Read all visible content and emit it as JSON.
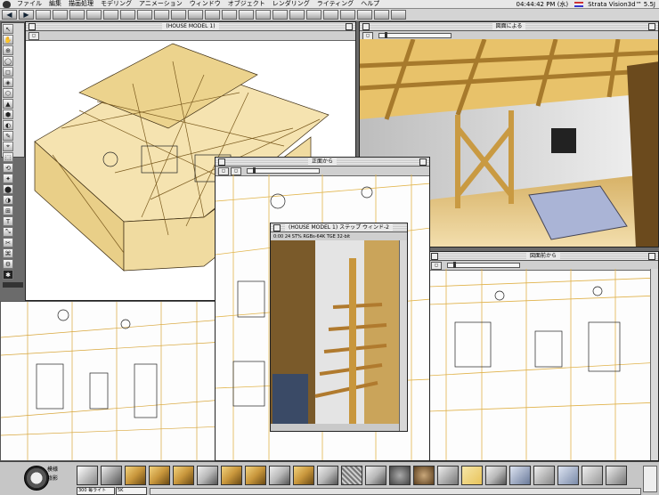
{
  "menubar": {
    "items": [
      "ファイル",
      "編集",
      "描画処理",
      "モデリング",
      "アニメーション",
      "ウィンドウ",
      "オブジェクト",
      "レンダリング",
      "ライティング",
      "ヘルプ"
    ],
    "clock": "04:44:42 PM (水)",
    "app_name": "Strata Vision3d™ 5.5J"
  },
  "toolbar": {
    "buttons": [
      "◀",
      "▶",
      "",
      "",
      "",
      "",
      "",
      "",
      "",
      "",
      "",
      "",
      "",
      "",
      "",
      "",
      "",
      "",
      "",
      "",
      "",
      "",
      "",
      ""
    ]
  },
  "palette": {
    "tools": [
      "↖",
      "✋",
      "⊕",
      "◯",
      "◻",
      "◈",
      "⬡",
      "▲",
      "⬢",
      "◐",
      "✎",
      "⌖",
      "⬚",
      "⟲",
      "✦",
      "⬤",
      "◑",
      "⊞",
      "T",
      "⤡",
      "✂",
      "⌘",
      "⚙",
      "✱"
    ]
  },
  "windows": {
    "house_model": {
      "title": "(HOUSE MODEL 1)"
    },
    "top_right": {
      "title": "図面による"
    },
    "center": {
      "title": "正面から"
    },
    "render": {
      "title": "(HOUSE MODEL 1) ステップ ウィンド-2",
      "info": "0:00  24  ST%  RGBs-64K  TGE  32-bit"
    },
    "bottom_right": {
      "title": "図面前から"
    }
  },
  "bottom_palette": {
    "label_top": "模様",
    "label_mid": "陰影",
    "select_value": "300 毎ライト",
    "field_value": "5K",
    "colors": {
      "gold": "#c8963c",
      "silver": "#b8b8b8",
      "wire": "#e8c35a",
      "render_sky": "#e9e9e9"
    }
  }
}
